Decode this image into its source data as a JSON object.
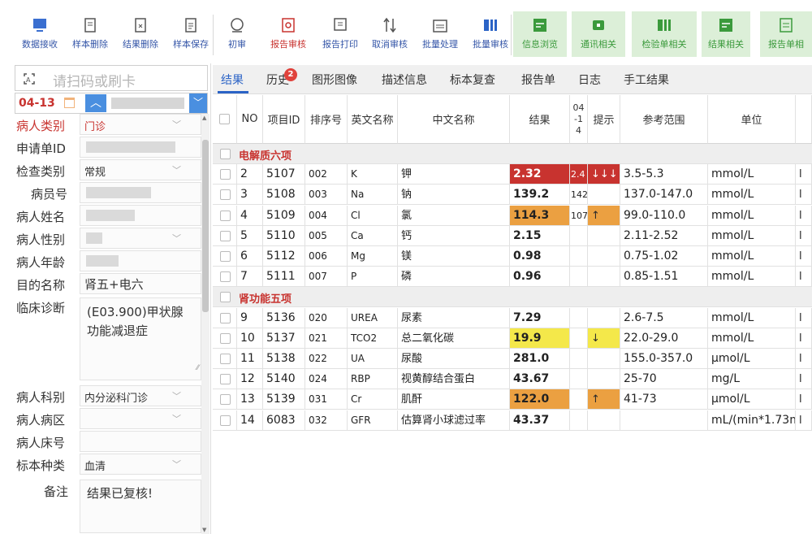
{
  "toolbar": {
    "buttons": [
      {
        "label": "数据接收",
        "icon": "data-receive-icon",
        "style": "blue"
      },
      {
        "label": "样本删除",
        "icon": "sample-delete-icon",
        "style": "blue"
      },
      {
        "label": "结果删除",
        "icon": "result-delete-icon",
        "style": "blue"
      },
      {
        "label": "样本保存",
        "icon": "sample-save-icon",
        "style": "blue"
      },
      {
        "label": "初审",
        "icon": "first-review-icon",
        "style": "blue"
      },
      {
        "label": "报告审核",
        "icon": "report-review-icon",
        "style": "red"
      },
      {
        "label": "报告打印",
        "icon": "report-print-icon",
        "style": "blue"
      },
      {
        "label": "取消审核",
        "icon": "cancel-review-icon",
        "style": "blue"
      },
      {
        "label": "批量处理",
        "icon": "batch-process-icon",
        "style": "blue"
      },
      {
        "label": "批量审核",
        "icon": "batch-review-icon",
        "style": "blue"
      },
      {
        "label": "信息浏览",
        "icon": "info-browse-icon",
        "style": "green"
      },
      {
        "label": "通讯相关",
        "icon": "communication-icon",
        "style": "green"
      },
      {
        "label": "检验单相关",
        "icon": "test-form-icon",
        "style": "green"
      },
      {
        "label": "结果相关",
        "icon": "result-related-icon",
        "style": "green"
      },
      {
        "label": "报告单相",
        "icon": "report-form-icon",
        "style": "green"
      }
    ]
  },
  "left": {
    "scan_placeholder": "请扫码或刷卡",
    "date": "04-13",
    "fields": {
      "patient_type": {
        "label": "病人类别",
        "value": "门诊"
      },
      "request_id": {
        "label": "申请单ID",
        "value": ""
      },
      "exam_type": {
        "label": "检查类别",
        "value": "常规"
      },
      "patient_no": {
        "label": "病员号",
        "value": ""
      },
      "patient_name": {
        "label": "病人姓名",
        "value": ""
      },
      "patient_sex": {
        "label": "病人性别",
        "value": ""
      },
      "patient_age": {
        "label": "病人年龄",
        "value": ""
      },
      "purpose": {
        "label": "目的名称",
        "value": "肾五+电六"
      },
      "diagnosis": {
        "label": "临床诊断",
        "value": "(E03.900)甲状腺功能减退症"
      },
      "department": {
        "label": "病人科别",
        "value": "内分泌科门诊"
      },
      "ward": {
        "label": "病人病区",
        "value": ""
      },
      "bed": {
        "label": "病人床号",
        "value": ""
      },
      "sample_type": {
        "label": "标本种类",
        "value": "血清"
      },
      "remark": {
        "label": "备注",
        "value": "结果已复核!"
      }
    }
  },
  "tabs": [
    {
      "label": "结果",
      "active": true
    },
    {
      "label": "历史",
      "badge": "2"
    },
    {
      "label": "图形图像"
    },
    {
      "label": "描述信息"
    },
    {
      "label": "标本复查"
    },
    {
      "label": "报告单"
    },
    {
      "label": "日志"
    },
    {
      "label": "手工结果"
    }
  ],
  "grid": {
    "headers": {
      "no": "NO",
      "item_id": "项目ID",
      "seq": "排序号",
      "en": "英文名称",
      "cn": "中文名称",
      "result": "结果",
      "prev": "04\n-1\n4",
      "hint": "提示",
      "range": "参考范围",
      "unit": "单位"
    },
    "groups": [
      {
        "title": "电解质六项",
        "rows": [
          {
            "no": "2",
            "id": "5107",
            "seq": "002",
            "en": "K",
            "cn": "钾",
            "result": "2.32",
            "prev": "2.4",
            "hint": "↓↓↓",
            "range": "3.5-5.3",
            "unit": "mmol/L",
            "flag": "critical"
          },
          {
            "no": "3",
            "id": "5108",
            "seq": "003",
            "en": "Na",
            "cn": "钠",
            "result": "139.2",
            "prev": "142",
            "hint": "",
            "range": "137.0-147.0",
            "unit": "mmol/L",
            "flag": ""
          },
          {
            "no": "4",
            "id": "5109",
            "seq": "004",
            "en": "Cl",
            "cn": "氯",
            "result": "114.3",
            "prev": "107",
            "hint": "↑",
            "range": "99.0-110.0",
            "unit": "mmol/L",
            "flag": "high"
          },
          {
            "no": "5",
            "id": "5110",
            "seq": "005",
            "en": "Ca",
            "cn": "钙",
            "result": "2.15",
            "prev": "",
            "hint": "",
            "range": "2.11-2.52",
            "unit": "mmol/L",
            "flag": ""
          },
          {
            "no": "6",
            "id": "5112",
            "seq": "006",
            "en": "Mg",
            "cn": "镁",
            "result": "0.98",
            "prev": "",
            "hint": "",
            "range": "0.75-1.02",
            "unit": "mmol/L",
            "flag": ""
          },
          {
            "no": "7",
            "id": "5111",
            "seq": "007",
            "en": "P",
            "cn": "磷",
            "result": "0.96",
            "prev": "",
            "hint": "",
            "range": "0.85-1.51",
            "unit": "mmol/L",
            "flag": ""
          }
        ]
      },
      {
        "title": "肾功能五项",
        "rows": [
          {
            "no": "9",
            "id": "5136",
            "seq": "020",
            "en": "UREA",
            "cn": "尿素",
            "result": "7.29",
            "prev": "",
            "hint": "",
            "range": "2.6-7.5",
            "unit": "mmol/L",
            "flag": ""
          },
          {
            "no": "10",
            "id": "5137",
            "seq": "021",
            "en": "TCO2",
            "cn": "总二氧化碳",
            "result": "19.9",
            "prev": "",
            "hint": "↓",
            "range": "22.0-29.0",
            "unit": "mmol/L",
            "flag": "low"
          },
          {
            "no": "11",
            "id": "5138",
            "seq": "022",
            "en": "UA",
            "cn": "尿酸",
            "result": "281.0",
            "prev": "",
            "hint": "",
            "range": "155.0-357.0",
            "unit": "μmol/L",
            "flag": ""
          },
          {
            "no": "12",
            "id": "5140",
            "seq": "024",
            "en": "RBP",
            "cn": "视黄醇结合蛋白",
            "result": "43.67",
            "prev": "",
            "hint": "",
            "range": "25-70",
            "unit": "mg/L",
            "flag": ""
          },
          {
            "no": "13",
            "id": "5139",
            "seq": "031",
            "en": "Cr",
            "cn": "肌酐",
            "result": "122.0",
            "prev": "",
            "hint": "↑",
            "range": "41-73",
            "unit": "μmol/L",
            "flag": "high"
          },
          {
            "no": "14",
            "id": "6083",
            "seq": "032",
            "en": "GFR",
            "cn": "估算肾小球滤过率",
            "result": "43.37",
            "prev": "",
            "hint": "",
            "range": "",
            "unit": "mL/(min*1.73m",
            "flag": ""
          }
        ]
      }
    ]
  },
  "colors": {
    "critical": "#c8332f",
    "high": "#eba041",
    "low": "#f4e84a",
    "accent": "#2b63c6",
    "group_title": "#c8332f"
  }
}
